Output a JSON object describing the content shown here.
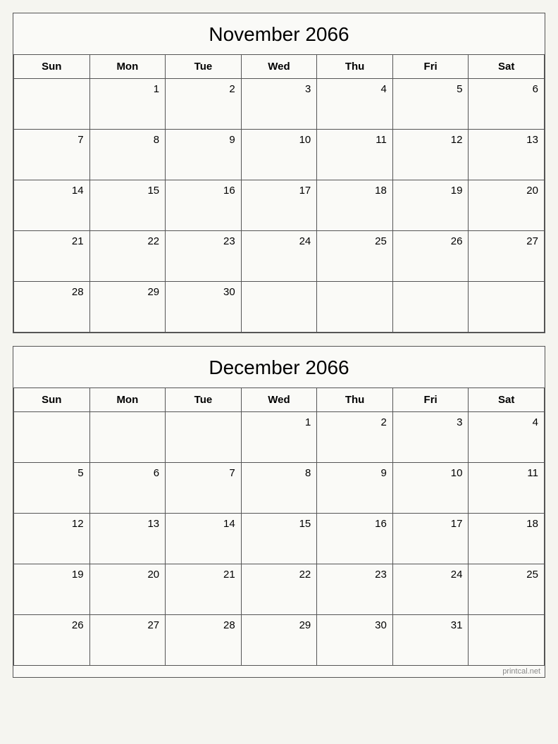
{
  "november": {
    "title": "November 2066",
    "headers": [
      "Sun",
      "Mon",
      "Tue",
      "Wed",
      "Thu",
      "Fri",
      "Sat"
    ],
    "weeks": [
      [
        "",
        "1",
        "2",
        "3",
        "4",
        "5",
        "6"
      ],
      [
        "7",
        "8",
        "9",
        "10",
        "11",
        "12",
        "13"
      ],
      [
        "14",
        "15",
        "16",
        "17",
        "18",
        "19",
        "20"
      ],
      [
        "21",
        "22",
        "23",
        "24",
        "25",
        "26",
        "27"
      ],
      [
        "28",
        "29",
        "30",
        "",
        "",
        "",
        ""
      ]
    ]
  },
  "december": {
    "title": "December 2066",
    "headers": [
      "Sun",
      "Mon",
      "Tue",
      "Wed",
      "Thu",
      "Fri",
      "Sat"
    ],
    "weeks": [
      [
        "",
        "",
        "",
        "1",
        "2",
        "3",
        "4"
      ],
      [
        "5",
        "6",
        "7",
        "8",
        "9",
        "10",
        "11"
      ],
      [
        "12",
        "13",
        "14",
        "15",
        "16",
        "17",
        "18"
      ],
      [
        "19",
        "20",
        "21",
        "22",
        "23",
        "24",
        "25"
      ],
      [
        "26",
        "27",
        "28",
        "29",
        "30",
        "31",
        ""
      ]
    ]
  },
  "watermark": "printcal.net"
}
